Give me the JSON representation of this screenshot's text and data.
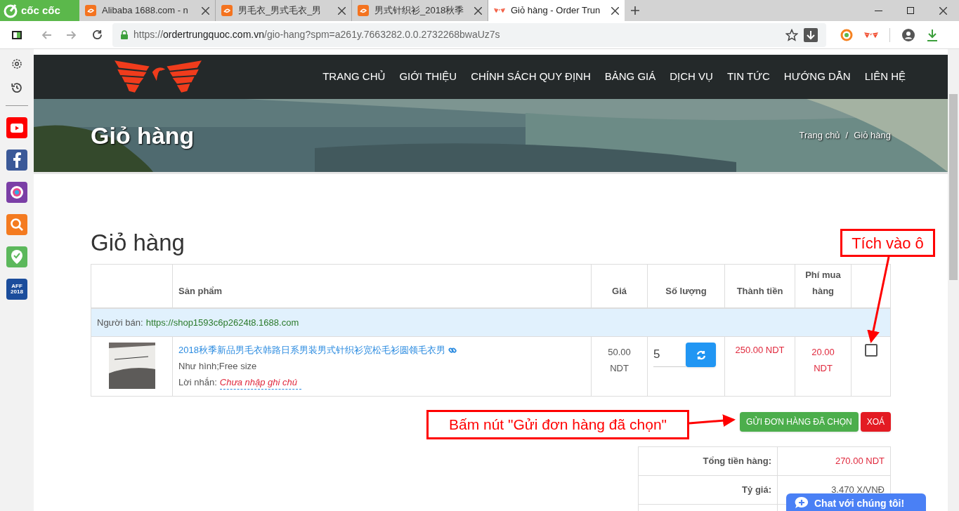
{
  "browser": {
    "brand": "cốc cốc",
    "tabs": [
      {
        "label": "Alibaba 1688.com - n",
        "selected": false
      },
      {
        "label": "男毛衣_男式毛衣_男",
        "selected": false
      },
      {
        "label": "男式针织衫_2018秋季",
        "selected": false
      },
      {
        "label": "Giỏ hàng - Order Trun",
        "selected": true
      }
    ],
    "url": {
      "scheme": "https://",
      "host": "ordertrungquoc.com.vn",
      "path": "/gio-hang?spm=a261y.7663282.0.0.2732268bwaUz7s"
    }
  },
  "sidebar": {
    "icons": [
      {
        "kind": "settings"
      },
      {
        "kind": "history"
      },
      {
        "kind": "youtube"
      },
      {
        "kind": "facebook"
      },
      {
        "kind": "music"
      },
      {
        "kind": "search"
      },
      {
        "kind": "map"
      },
      {
        "kind": "aff"
      }
    ],
    "aff_label": "AFF",
    "aff_year": "2018"
  },
  "nav": [
    "TRANG CHỦ",
    "GIỚI THIỆU",
    "CHÍNH SÁCH QUY ĐỊNH",
    "BẢNG GIÁ",
    "DỊCH VỤ",
    "TIN TỨC",
    "HƯỚNG DẪN",
    "LIÊN HỆ"
  ],
  "banner": {
    "title": "Giỏ hàng",
    "breadcrumb": [
      "Trang chủ",
      "Giỏ hàng"
    ],
    "separator": "/"
  },
  "heading": "Giỏ hàng",
  "table": {
    "columns": [
      "Sản phẩm",
      "Giá",
      "Số lượng",
      "Thành tiền",
      "Phí mua hàng"
    ],
    "seller": {
      "label": "Người bán:",
      "link": "https://shop1593c6p2624t8.1688.com"
    },
    "rows": [
      {
        "title": "2018秋季新品男毛衣韩路日系男装男式针织衫宽松毛衫圆领毛衣男",
        "variant": "Như hình;Free size",
        "note_label": "Lời nhắn:",
        "note_placeholder": "Chưa nhập ghi chú",
        "price": "50.00 NDT",
        "quantity": "5",
        "total": "250.00 NDT",
        "fee": "20.00 NDT",
        "checked": false
      }
    ]
  },
  "buttons": [
    {
      "label": "GỬI ĐƠN HÀNG ĐÃ CHỌN",
      "kind": "send"
    },
    {
      "label": "XOÁ",
      "kind": "delete"
    }
  ],
  "summary": [
    {
      "label": "Tổng tiền hàng:",
      "value": "270.00 NDT",
      "kind": "money"
    },
    {
      "label": "Tỷ giá:",
      "value": "3.470 X/VNĐ",
      "kind": "plain"
    }
  ],
  "chat": "Chat với chúng tôi!",
  "annotations": [
    {
      "text": "Tích vào ô"
    },
    {
      "text": "Bấm nút \"Gửi đơn hàng đã chọn\""
    }
  ]
}
